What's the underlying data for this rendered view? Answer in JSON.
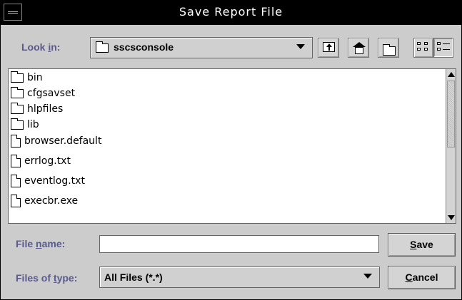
{
  "window": {
    "title": "Save Report File"
  },
  "look_in": {
    "label_pre": "Look ",
    "label_mnemonic": "i",
    "label_post": "n:",
    "value": "sscsconsole"
  },
  "file_list": [
    {
      "name": "bin",
      "type": "folder"
    },
    {
      "name": "cfgsavset",
      "type": "folder"
    },
    {
      "name": "hlpfiles",
      "type": "folder"
    },
    {
      "name": "lib",
      "type": "folder"
    },
    {
      "name": "browser.default",
      "type": "file"
    },
    {
      "name": "errlog.txt",
      "type": "file"
    },
    {
      "name": "eventlog.txt",
      "type": "file"
    },
    {
      "name": "execbr.exe",
      "type": "file"
    }
  ],
  "file_name": {
    "label_pre": "File ",
    "label_mnemonic": "n",
    "label_post": "ame:",
    "value": "",
    "placeholder": ""
  },
  "files_of_type": {
    "label_pre": "Files of ",
    "label_mnemonic": "t",
    "label_post": "ype:",
    "value": "All Files (*.*)"
  },
  "buttons": {
    "save_mnemonic": "S",
    "save_rest": "ave",
    "cancel_mnemonic": "C",
    "cancel_rest": "ancel"
  },
  "toolbar_icons": [
    "up-one-level-icon",
    "home-icon",
    "new-folder-icon",
    "list-view-icon",
    "details-view-icon"
  ],
  "colors": {
    "label": "#5a5a8c",
    "title_bg": "#000000",
    "dialog_bg": "#cccccc"
  }
}
